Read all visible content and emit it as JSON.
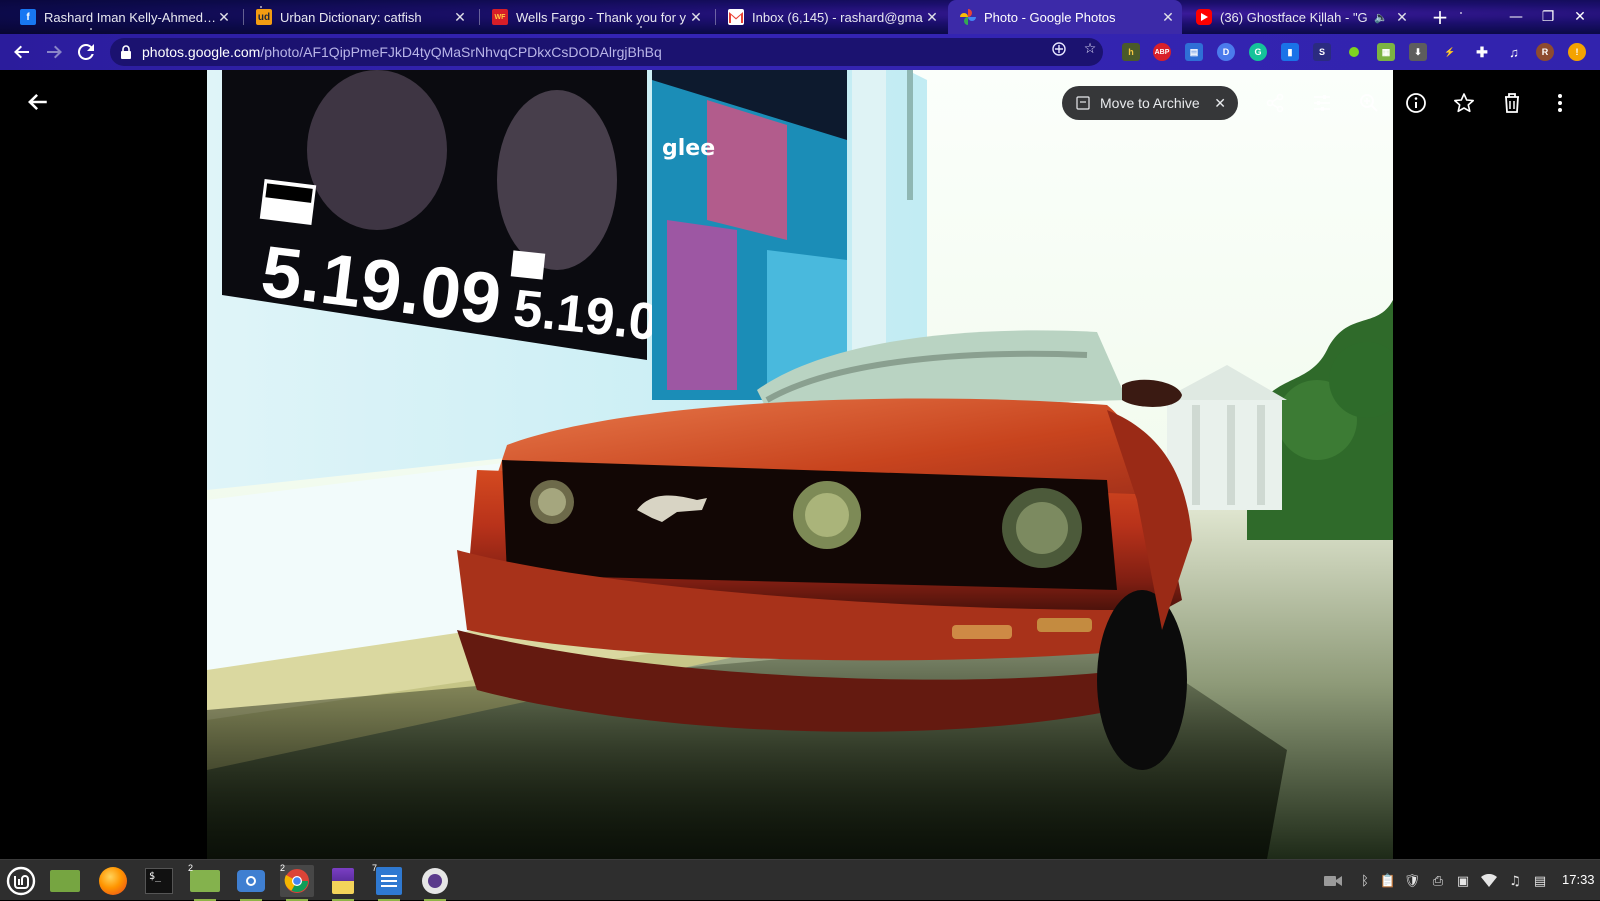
{
  "browser": {
    "tabs": [
      {
        "title": "Rashard Iman Kelly-Ahmed O",
        "favicon": "facebook-icon",
        "color": "#1877f2"
      },
      {
        "title": "Urban Dictionary: catfish",
        "favicon": "urban-dictionary-icon",
        "color": "#f39c12"
      },
      {
        "title": "Wells Fargo - Thank you for y",
        "favicon": "wells-fargo-icon",
        "color": "#d71e28"
      },
      {
        "title": "Inbox (6,145) - rashard@gma",
        "favicon": "gmail-icon",
        "color": "#ea4335"
      },
      {
        "title": "Photo - Google Photos",
        "favicon": "google-photos-icon",
        "color": "#fbbc04",
        "active": true
      },
      {
        "title": "(36) Ghostface Killah - \"G",
        "favicon": "youtube-icon",
        "color": "#ff0000"
      }
    ],
    "url_host": "photos.google.com",
    "url_path": "/photo/AF1QipPmeFJkD4tyQMaSrNhvqCPDkxCsDODAlrgjBhBq"
  },
  "viewer": {
    "archive_label": "Move to Archive",
    "photo": {
      "poster_date_1": "5.19.09",
      "poster_date_2": "5.19.09",
      "advisory_label": "PARENTAL ADVISORY",
      "poster_word": "glee"
    }
  },
  "taskbar": {
    "apps": [
      {
        "name": "mint-menu",
        "running": false
      },
      {
        "name": "show-desktop",
        "running": false
      },
      {
        "name": "firefox",
        "running": false
      },
      {
        "name": "terminal",
        "running": false
      },
      {
        "name": "files",
        "running": true,
        "count": "2"
      },
      {
        "name": "screenshot",
        "running": true
      },
      {
        "name": "chrome",
        "running": true,
        "count": "2"
      },
      {
        "name": "sticky-notes",
        "running": true
      },
      {
        "name": "text-editor",
        "running": true,
        "count": "7"
      },
      {
        "name": "camera",
        "running": true
      }
    ],
    "clock": "17:33"
  }
}
